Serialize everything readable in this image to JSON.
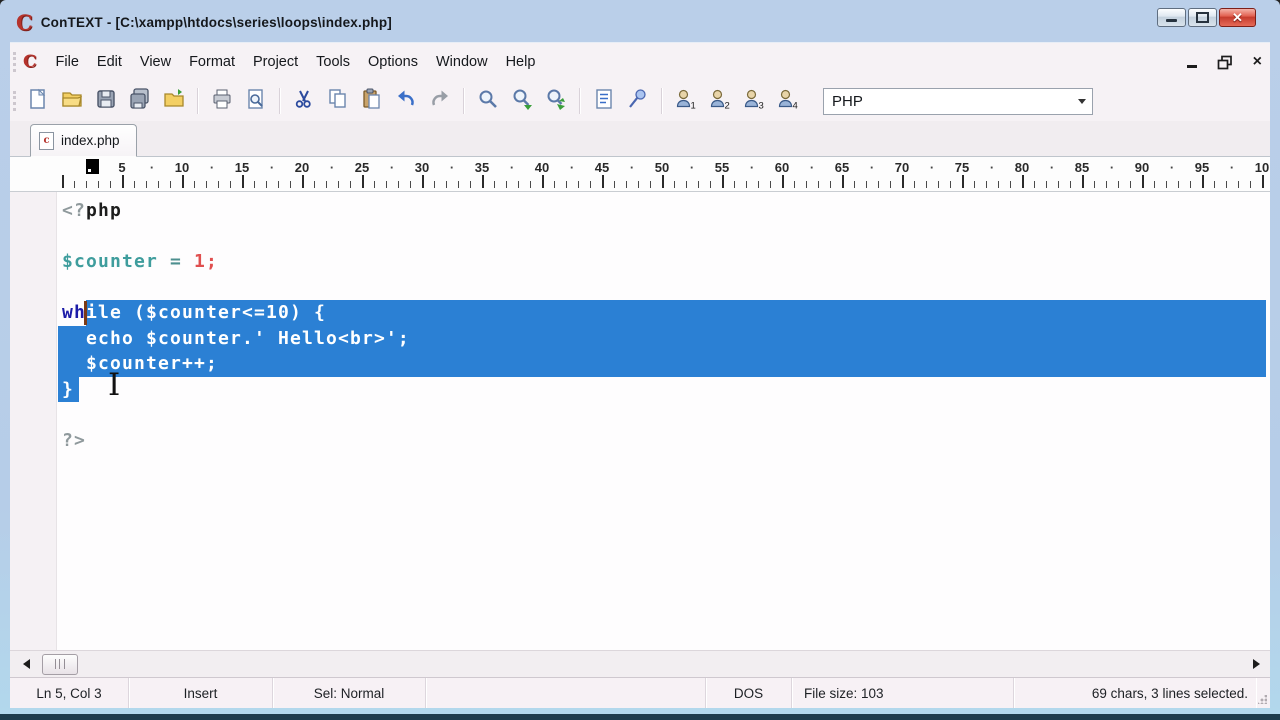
{
  "window": {
    "title": "ConTEXT - [C:\\xampp\\htdocs\\series\\loops\\index.php]"
  },
  "colors": {
    "titlebar_blue": "#b6cde8",
    "chrome_bg": "#f6f2f5",
    "selection_blue": "#2b80d4",
    "keyword_navy": "#1c1ca8",
    "variable_teal": "#3f9d9d",
    "number_red": "#e04f4f",
    "phptag_gray": "#8f999c",
    "close_button_red": "#d9503f",
    "caret_brown": "#7a3a16"
  },
  "menu": {
    "items": [
      "File",
      "Edit",
      "View",
      "Format",
      "Project",
      "Tools",
      "Options",
      "Window",
      "Help"
    ]
  },
  "toolbar": {
    "language": "PHP",
    "items": [
      {
        "type": "icon",
        "name": "new-file-icon"
      },
      {
        "type": "icon",
        "name": "open-file-icon"
      },
      {
        "type": "icon",
        "name": "save-icon"
      },
      {
        "type": "icon",
        "name": "save-all-icon"
      },
      {
        "type": "icon",
        "name": "open-folder-icon"
      },
      {
        "type": "sep"
      },
      {
        "type": "icon",
        "name": "print-icon"
      },
      {
        "type": "icon",
        "name": "print-preview-icon"
      },
      {
        "type": "sep"
      },
      {
        "type": "icon",
        "name": "cut-icon"
      },
      {
        "type": "icon",
        "name": "copy-icon"
      },
      {
        "type": "icon",
        "name": "paste-icon"
      },
      {
        "type": "icon",
        "name": "undo-icon"
      },
      {
        "type": "icon",
        "name": "redo-icon"
      },
      {
        "type": "sep"
      },
      {
        "type": "icon",
        "name": "find-icon"
      },
      {
        "type": "icon",
        "name": "find-next-icon"
      },
      {
        "type": "icon",
        "name": "find-replace-icon"
      },
      {
        "type": "sep"
      },
      {
        "type": "icon",
        "name": "code-templates-icon"
      },
      {
        "type": "icon",
        "name": "pin-icon"
      },
      {
        "type": "sep"
      },
      {
        "type": "icon",
        "name": "user-command-1-icon",
        "badge": "1"
      },
      {
        "type": "icon",
        "name": "user-command-2-icon",
        "badge": "2"
      },
      {
        "type": "icon",
        "name": "user-command-3-icon",
        "badge": "3"
      },
      {
        "type": "icon",
        "name": "user-command-4-icon",
        "badge": "4"
      }
    ]
  },
  "tabs": [
    {
      "label": "index.php",
      "active": true
    }
  ],
  "ruler": {
    "labels": [
      "5",
      "10",
      "15",
      "20",
      "25",
      "30",
      "35",
      "40",
      "45",
      "50",
      "55",
      "60",
      "65",
      "70",
      "75",
      "80",
      "85",
      "90",
      "95",
      "10"
    ],
    "cursor_column_marker": 3
  },
  "editor": {
    "lines": [
      {
        "tokens": [
          {
            "t": "<?",
            "c": "tag"
          },
          {
            "t": "php",
            "c": "phptag"
          }
        ]
      },
      {
        "tokens": []
      },
      {
        "tokens": [
          {
            "t": "$counter",
            "c": "var"
          },
          {
            "t": " ",
            "c": "plain"
          },
          {
            "t": "=",
            "c": "op"
          },
          {
            "t": " ",
            "c": "plain"
          },
          {
            "t": "1",
            "c": "num"
          },
          {
            "t": ";",
            "c": "num"
          }
        ]
      },
      {
        "tokens": []
      },
      {
        "tokens": [
          {
            "t": "wh",
            "c": "kw"
          },
          {
            "t": "ile",
            "c": "kw",
            "sel": true
          },
          {
            "t": " ($counter<=10) {",
            "c": "plain",
            "sel": true
          }
        ]
      },
      {
        "tokens": [
          {
            "t": "  ",
            "c": "plain",
            "sel": true
          },
          {
            "t": "echo",
            "c": "kw",
            "sel": true
          },
          {
            "t": " $counter.' Hello<br>';",
            "c": "plain",
            "sel": true
          }
        ]
      },
      {
        "tokens": [
          {
            "t": "  $counter++;",
            "c": "plain",
            "sel": true
          }
        ]
      },
      {
        "tokens": [
          {
            "t": "}",
            "c": "plain",
            "sel": true
          }
        ]
      },
      {
        "tokens": []
      },
      {
        "tokens": [
          {
            "t": "?>",
            "c": "tag"
          }
        ]
      }
    ]
  },
  "statusbar": {
    "cells": [
      {
        "name": "cursor-position",
        "text": "Ln 5, Col 3"
      },
      {
        "name": "insert-mode",
        "text": "Insert"
      },
      {
        "name": "selection-mode",
        "text": "Sel: Normal"
      },
      {
        "name": "spacer",
        "text": ""
      },
      {
        "name": "line-ending",
        "text": "DOS"
      },
      {
        "name": "file-size",
        "text": "File size: 103"
      },
      {
        "name": "selection-info",
        "text": "69 chars, 3 lines selected."
      }
    ]
  }
}
